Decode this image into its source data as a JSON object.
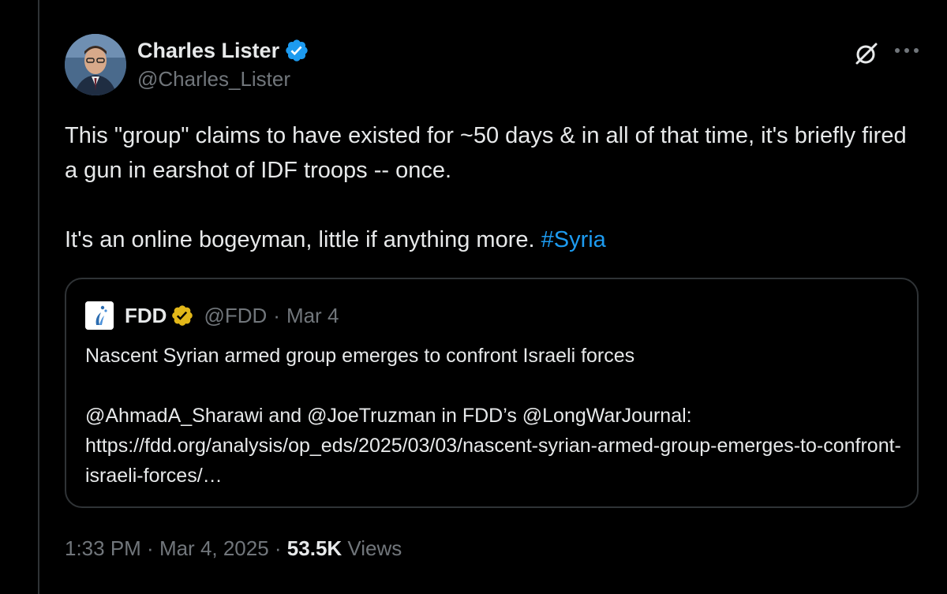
{
  "author": {
    "name": "Charles Lister",
    "handle": "@Charles_Lister",
    "badge_color": "#1d9bf0"
  },
  "tweet": {
    "line1": "This \"group\" claims to have existed for ~50 days & in all of that time, it's briefly fired a gun in earshot of IDF troops -- once.",
    "line2_text": "It's an online bogeyman, little if anything more. ",
    "line2_hashtag": "#Syria"
  },
  "quote": {
    "name": "FDD",
    "handle": "@FDD",
    "separator": "·",
    "date": "Mar 4",
    "badge_color": "#e2b719",
    "title": "Nascent Syrian armed group emerges to confront Israeli forces",
    "body": "@AhmadA_Sharawi and @JoeTruzman in FDD’s @LongWarJournal: https://fdd.org/analysis/op_eds/2025/03/03/nascent-syrian-armed-group-emerges-to-confront-israeli-forces/…"
  },
  "meta": {
    "time": "1:33 PM",
    "separator": " · ",
    "date": "Mar 4, 2025",
    "views_count": "53.5K",
    "views_label": " Views"
  },
  "icons": {
    "grok": "grok-icon",
    "more": "more-icon",
    "verified": "verified-badge-icon"
  },
  "colors": {
    "background": "#000000",
    "text": "#e7e9ea",
    "secondary": "#71767b",
    "link": "#1d9bf0",
    "border": "#2f3336"
  }
}
